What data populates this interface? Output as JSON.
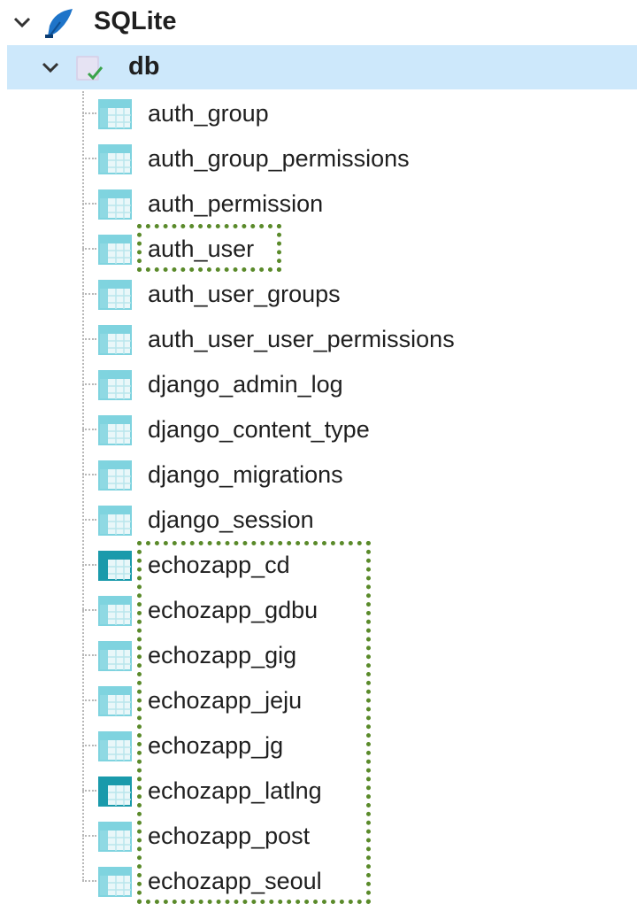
{
  "tree": {
    "root": {
      "label": "SQLite",
      "icon": "sqlite-feather-icon",
      "expanded": true
    },
    "database": {
      "label": "db",
      "icon": "database-connected-icon",
      "expanded": true,
      "selected": true
    },
    "tables": [
      {
        "label": "auth_group",
        "icon": "table-icon"
      },
      {
        "label": "auth_group_permissions",
        "icon": "table-icon"
      },
      {
        "label": "auth_permission",
        "icon": "table-icon"
      },
      {
        "label": "auth_user",
        "icon": "table-icon"
      },
      {
        "label": "auth_user_groups",
        "icon": "table-icon"
      },
      {
        "label": "auth_user_user_permissions",
        "icon": "table-icon"
      },
      {
        "label": "django_admin_log",
        "icon": "table-icon"
      },
      {
        "label": "django_content_type",
        "icon": "table-icon"
      },
      {
        "label": "django_migrations",
        "icon": "table-icon"
      },
      {
        "label": "django_session",
        "icon": "table-icon"
      },
      {
        "label": "echozapp_cd",
        "icon": "table-icon-dark"
      },
      {
        "label": "echozapp_gdbu",
        "icon": "table-icon"
      },
      {
        "label": "echozapp_gig",
        "icon": "table-icon"
      },
      {
        "label": "echozapp_jeju",
        "icon": "table-icon"
      },
      {
        "label": "echozapp_jg",
        "icon": "table-icon"
      },
      {
        "label": "echozapp_latlng",
        "icon": "table-icon-dark"
      },
      {
        "label": "echozapp_post",
        "icon": "table-icon"
      },
      {
        "label": "echozapp_seoul",
        "icon": "table-icon"
      }
    ]
  },
  "colors": {
    "selected_row": "#cde8fb",
    "highlight_border": "#5a8a2a",
    "table_icon_light": "#7fd3df",
    "table_icon_dark": "#1a9aab"
  }
}
